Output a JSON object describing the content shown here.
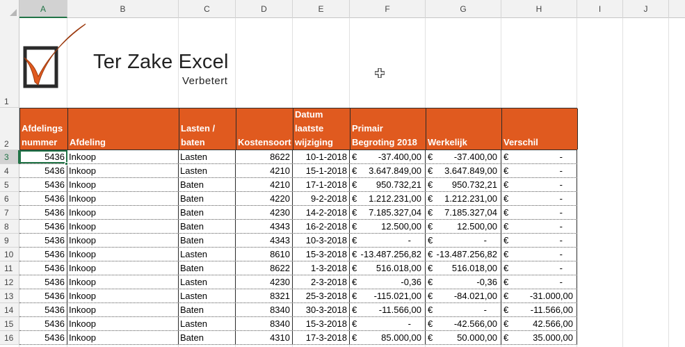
{
  "columns": [
    "A",
    "B",
    "C",
    "D",
    "E",
    "F",
    "G",
    "H",
    "I",
    "J"
  ],
  "selected_column": "A",
  "row_numbers": [
    "1",
    "2",
    "3",
    "4",
    "5",
    "6",
    "7",
    "8",
    "9",
    "10",
    "11",
    "12",
    "13",
    "14",
    "15",
    "16"
  ],
  "selected_row": "3",
  "logo": {
    "title": "Ter Zake Excel",
    "subtitle": "Verbetert",
    "accent_color": "#e05a1f"
  },
  "colors": {
    "header_fill": "#e05a1f",
    "header_text": "#ffffff",
    "selection_green": "#217346"
  },
  "table": {
    "headers": [
      [
        "Afdelings",
        "nummer"
      ],
      [
        "Afdeling"
      ],
      [
        "Lasten /",
        "baten"
      ],
      [
        "Kostensoort"
      ],
      [
        "Datum",
        "laatste",
        "wijziging"
      ],
      [
        "Primair",
        "Begroting 2018"
      ],
      [
        "Werkelijk"
      ],
      [
        "Verschil"
      ]
    ],
    "currency_symbol": "€",
    "rows": [
      [
        "5436",
        "Inkoop",
        "Lasten",
        "8622",
        "10-1-2018",
        "-37.400,00",
        "-37.400,00",
        "-"
      ],
      [
        "5436",
        "Inkoop",
        "Lasten",
        "4210",
        "15-1-2018",
        "3.647.849,00",
        "3.647.849,00",
        "-"
      ],
      [
        "5436",
        "Inkoop",
        "Baten",
        "4210",
        "17-1-2018",
        "950.732,21",
        "950.732,21",
        "-"
      ],
      [
        "5436",
        "Inkoop",
        "Baten",
        "4220",
        "9-2-2018",
        "1.212.231,00",
        "1.212.231,00",
        "-"
      ],
      [
        "5436",
        "Inkoop",
        "Baten",
        "4230",
        "14-2-2018",
        "7.185.327,04",
        "7.185.327,04",
        "-"
      ],
      [
        "5436",
        "Inkoop",
        "Baten",
        "4343",
        "16-2-2018",
        "12.500,00",
        "12.500,00",
        "-"
      ],
      [
        "5436",
        "Inkoop",
        "Baten",
        "4343",
        "10-3-2018",
        "-",
        "-",
        "-"
      ],
      [
        "5436",
        "Inkoop",
        "Lasten",
        "8610",
        "15-3-2018",
        "-13.487.256,82",
        "-13.487.256,82",
        "-"
      ],
      [
        "5436",
        "Inkoop",
        "Baten",
        "8622",
        "1-3-2018",
        "516.018,00",
        "516.018,00",
        "-"
      ],
      [
        "5436",
        "Inkoop",
        "Lasten",
        "4230",
        "2-3-2018",
        "-0,36",
        "-0,36",
        "-"
      ],
      [
        "5436",
        "Inkoop",
        "Lasten",
        "8321",
        "25-3-2018",
        "-115.021,00",
        "-84.021,00",
        "-31.000,00"
      ],
      [
        "5436",
        "Inkoop",
        "Baten",
        "8340",
        "30-3-2018",
        "-11.566,00",
        "-",
        "-11.566,00"
      ],
      [
        "5436",
        "Inkoop",
        "Lasten",
        "8340",
        "15-3-2018",
        "-",
        "-42.566,00",
        "42.566,00"
      ],
      [
        "5436",
        "Inkoop",
        "Baten",
        "4310",
        "17-3-2018",
        "85.000,00",
        "50.000,00",
        "35.000,00"
      ]
    ]
  }
}
